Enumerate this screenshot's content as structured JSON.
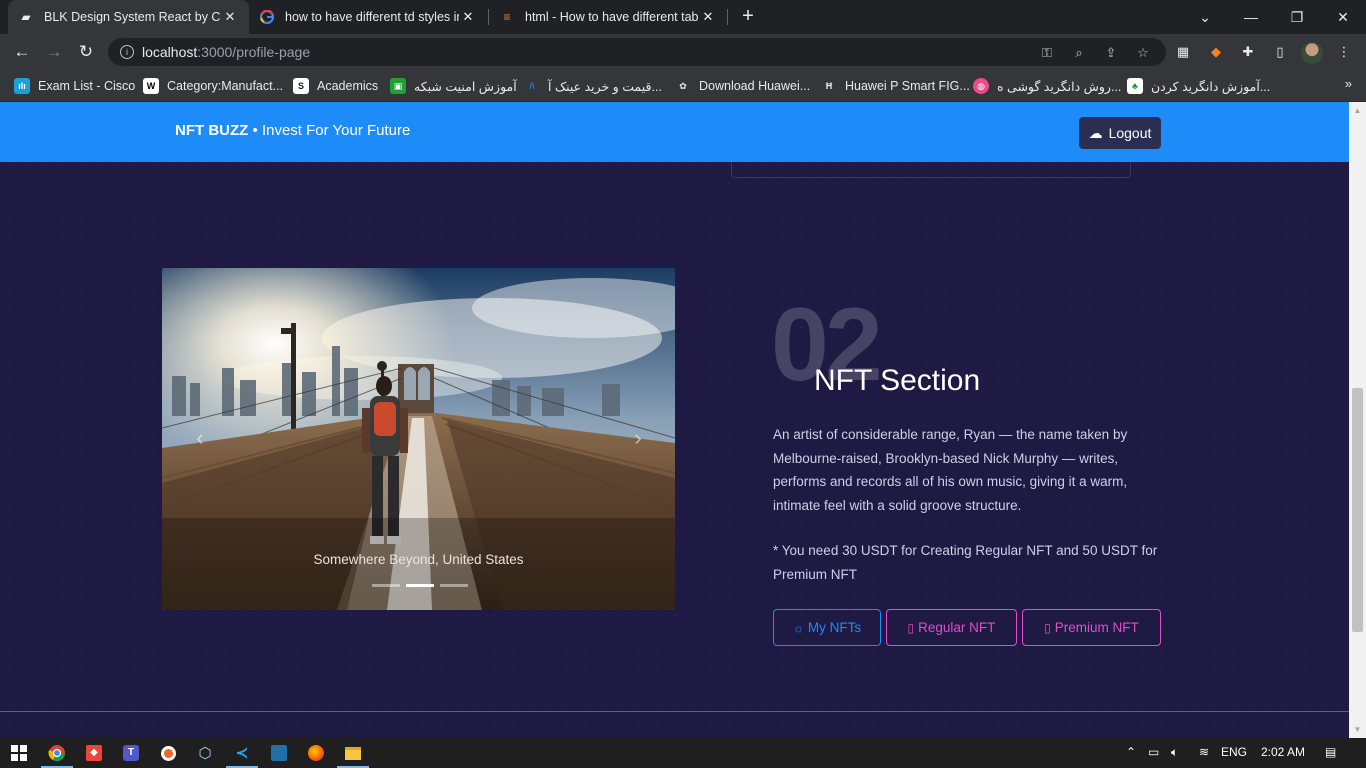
{
  "browser": {
    "tabs": [
      {
        "title": "BLK Design System React by Crea",
        "active": true
      },
      {
        "title": "how to have different td styles in",
        "active": false
      },
      {
        "title": "html - How to have different tabl",
        "active": false
      }
    ],
    "url_host": "localhost",
    "url_path": ":3000/profile-page",
    "bookmarks": [
      {
        "label": "Exam List - Cisco"
      },
      {
        "label": "Category:Manufact..."
      },
      {
        "label": "Academics"
      },
      {
        "label": "آموزش امنیت شبکه"
      },
      {
        "label": "قیمت و خرید عینک آ..."
      },
      {
        "label": "Download Huawei..."
      },
      {
        "label": "Huawei P Smart FIG..."
      },
      {
        "label": "روش دانگرید گوشی ه..."
      },
      {
        "label": "آموزش دانگرید کردن..."
      }
    ]
  },
  "page": {
    "brand": "NFT BUZZ",
    "brand_separator": "•",
    "tagline": "Invest For Your Future",
    "logout_label": "Logout",
    "carousel": {
      "caption": "Somewhere Beyond, United States",
      "slide_count": 3,
      "active_slide": 2
    },
    "section_number": "02",
    "section_title": "NFT Section",
    "description": "An artist of considerable range, Ryan — the name taken by Melbourne-raised, Brooklyn-based Nick Murphy — writes, performs and records all of his own music, giving it a warm, intimate feel with a solid groove structure.",
    "note": "* You need 30 USDT for Creating Regular NFT and 50 USDT for Premium NFT",
    "buttons": {
      "my_nfts": "My NFTs",
      "regular": "Regular NFT",
      "premium": "Premium NFT"
    },
    "colors": {
      "navbar": "#1d8cf8",
      "background": "#1e1a44",
      "info": "#1d8cf8",
      "primary": "#e14eca"
    }
  },
  "taskbar": {
    "language": "ENG",
    "time": "2:02 AM"
  }
}
